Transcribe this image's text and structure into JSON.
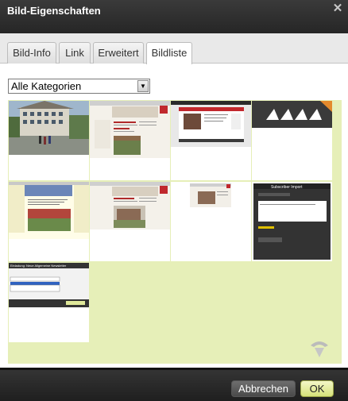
{
  "dialog": {
    "title": "Bild-Eigenschaften"
  },
  "tabs": [
    {
      "label": "Bild-Info"
    },
    {
      "label": "Link"
    },
    {
      "label": "Erweitert"
    },
    {
      "label": "Bildliste",
      "active": true
    }
  ],
  "category_select": {
    "value": "Alle Kategorien"
  },
  "gallery": {
    "thumbnails": [
      {
        "name": "thumbnail-school-building"
      },
      {
        "name": "thumbnail-website-red-header"
      },
      {
        "name": "thumbnail-website-dark-photo"
      },
      {
        "name": "thumbnail-dark-logo"
      },
      {
        "name": "thumbnail-website-yellow-page"
      },
      {
        "name": "thumbnail-website-building"
      },
      {
        "name": "thumbnail-small-website"
      },
      {
        "name": "thumbnail-subscriber-import-dialog"
      },
      {
        "name": "thumbnail-newsletter-dialog"
      }
    ],
    "mini_text": {
      "subscriber_import": "Subscriber Import",
      "newsletter_dialog": "Einladung: Neue Allgemeine Newsletter"
    }
  },
  "footer": {
    "cancel_label": "Abbrechen",
    "ok_label": "OK"
  },
  "colors": {
    "titlebar": "#2e2e2e",
    "gallery_bg": "#e6efb8",
    "ok_button": "#e2ea9c",
    "cancel_button": "#5a5a5a"
  }
}
